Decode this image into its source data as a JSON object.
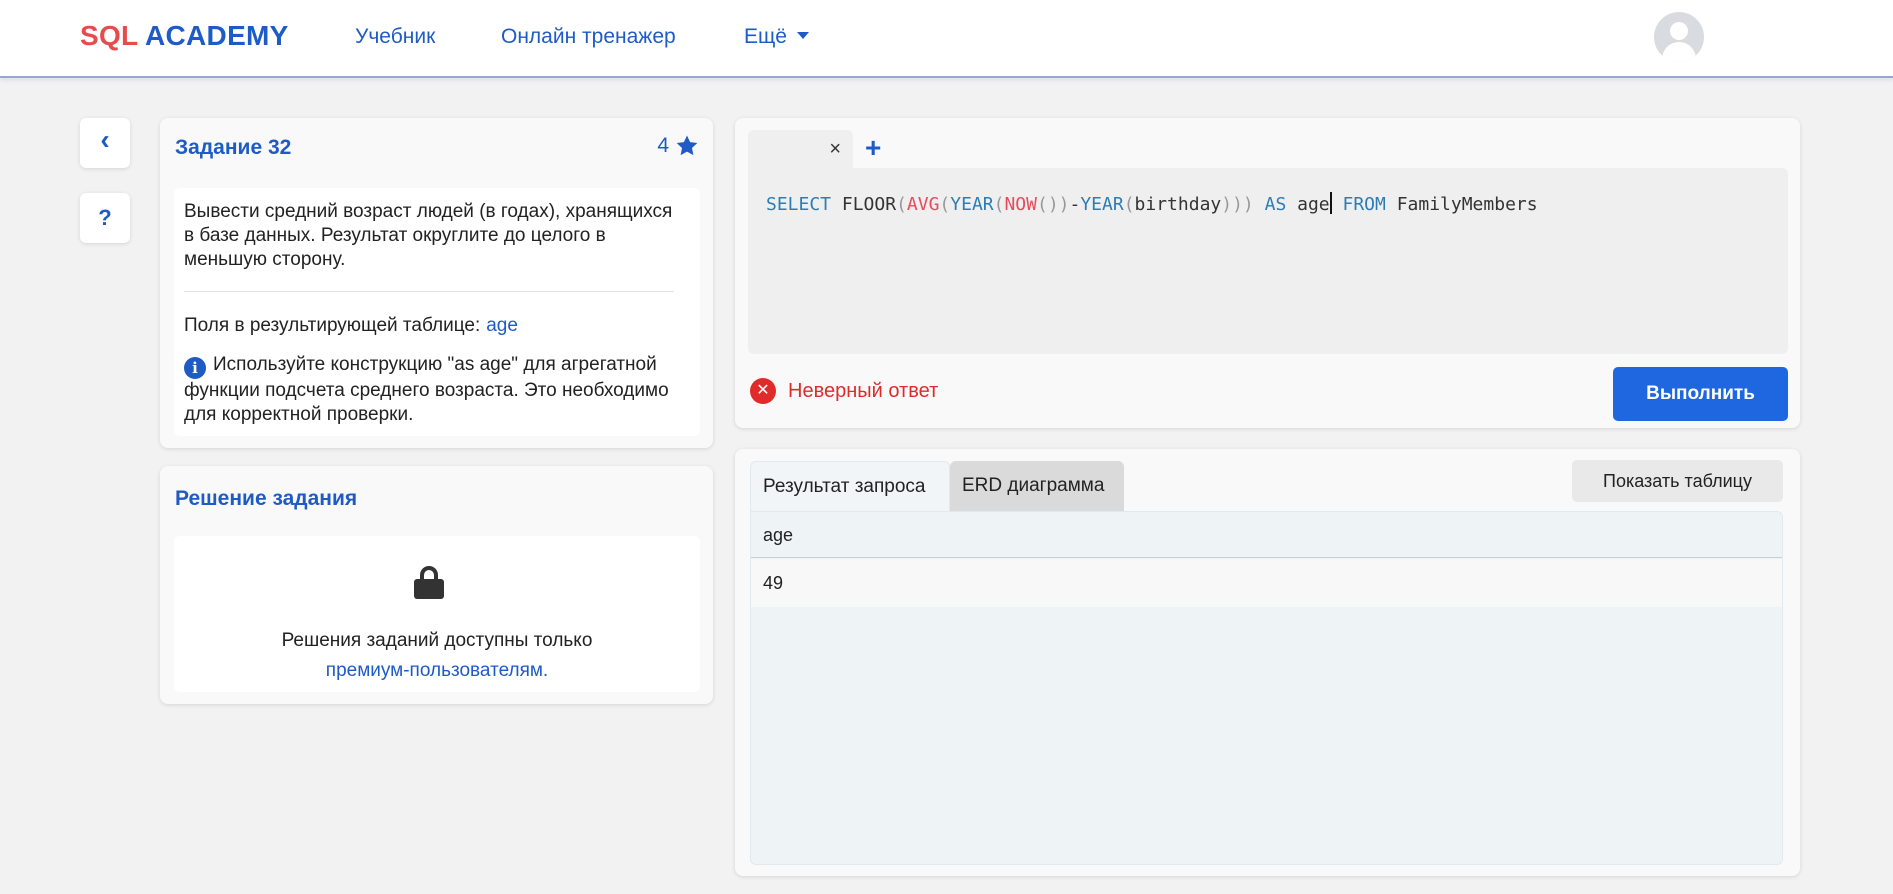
{
  "header": {
    "logo_part1": "SQL",
    "logo_part2": "ACADEMY",
    "nav": [
      "Учебник",
      "Онлайн тренажер",
      "Ещё"
    ]
  },
  "sidebar": {
    "back_icon": "‹",
    "help_icon": "?"
  },
  "task": {
    "title": "Задание 32",
    "stars": "4",
    "description": "Вывести средний возраст людей (в годах), хранящихся в базе данных. Результат округлите до целого в меньшую сторону.",
    "fields_label": "Поля в результирующей таблице:",
    "fields_value": "age",
    "hint": "Используйте конструкцию \"as age\" для агрегатной функции подсчета среднего возраста. Это необходимо для корректной проверки."
  },
  "solution": {
    "title": "Решение задания",
    "text": "Решения заданий доступны только",
    "link": "премиум-пользователям."
  },
  "editor": {
    "tab_close": "×",
    "add_tab": "+",
    "code": "SELECT FLOOR(AVG(YEAR(NOW())-YEAR(birthday))) AS age FROM FamilyMembers"
  },
  "status": {
    "error_text": "Неверный ответ"
  },
  "run_button": "Выполнить",
  "results": {
    "tabs": [
      "Результат запроса",
      "ERD диаграмма"
    ],
    "show_table": "Показать таблицу",
    "columns": [
      "age"
    ],
    "rows": [
      [
        "49"
      ]
    ]
  },
  "colors": {
    "brand": "#1e5bc6",
    "accent_red": "#e74c4c",
    "error": "#e02b2b",
    "button": "#1f67e0"
  }
}
